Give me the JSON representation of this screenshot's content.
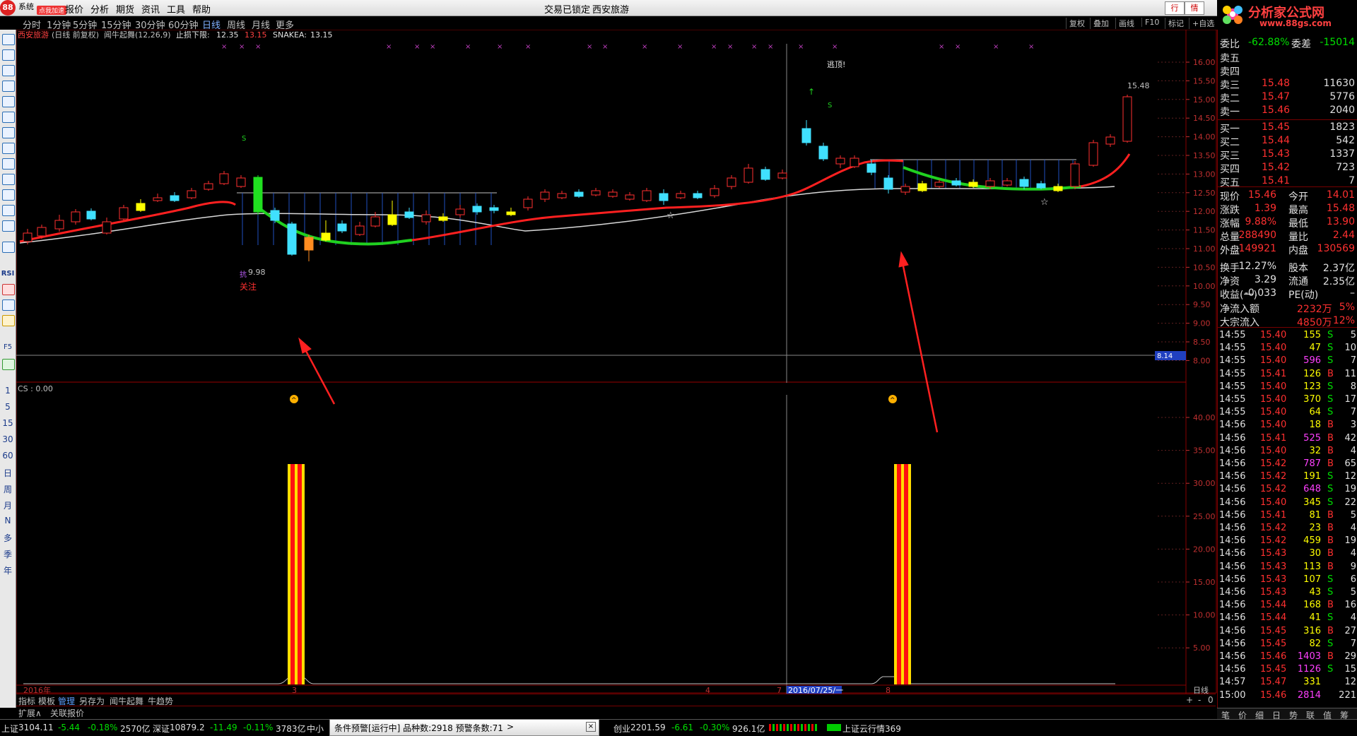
{
  "menu": {
    "items": [
      "系统",
      "报价",
      "分析",
      "期货",
      "资讯",
      "工具",
      "帮助"
    ],
    "badge": "点我加速",
    "logo": "88",
    "center_title": "交易已锁定",
    "stock_name": "西安旅游",
    "win_buttons": [
      "行",
      "情"
    ]
  },
  "periods": [
    "分时",
    "1分钟",
    "5分钟",
    "15分钟",
    "30分钟",
    "60分钟",
    "日线",
    "周线",
    "月线",
    "更多"
  ],
  "active_period": "日线",
  "right_tools": [
    "复权",
    "叠加",
    "画线",
    "F10",
    "标记",
    "+自选"
  ],
  "site_logo": {
    "name": "分析家公式网",
    "url": "www.88gs.com"
  },
  "chart_header": {
    "name": "西安旅游",
    "period": "(日线 前复权)",
    "indicator": "闻牛起舞(12,26,9)",
    "stop_label": "止损下限:",
    "stop_value": "12.35",
    "stop_value2": "13.15",
    "snake_label": "SNAKEA:",
    "snake_value": "13.15"
  },
  "annotations": {
    "top_text": "逃顶!",
    "low_label": "9.98",
    "low_text": "抗",
    "focus_text": "关注",
    "high_label": "15.48",
    "s_mark": "S",
    "price_tag": "8.14"
  },
  "price_axis": [
    "16.00",
    "15.50",
    "15.00",
    "14.50",
    "14.00",
    "13.50",
    "13.00",
    "12.50",
    "12.00",
    "11.50",
    "11.00",
    "10.50",
    "10.00",
    "9.50",
    "9.00",
    "8.50",
    "8.00"
  ],
  "indicator_header": "CS : 0.00",
  "indicator_axis": [
    "40.00",
    "35.00",
    "30.00",
    "25.00",
    "20.00",
    "15.00",
    "10.00",
    "5.00"
  ],
  "date_axis": {
    "year": "2016年",
    "m3": "3",
    "m4": "4",
    "m7": "7",
    "cursor": "2016/07/25/一",
    "m8": "8"
  },
  "timeframe_right": "日线",
  "left_labels": [
    "1",
    "5",
    "15",
    "30",
    "60",
    "日",
    "周",
    "月",
    "N",
    "多",
    "季",
    "年"
  ],
  "left_small": [
    "RSI",
    "F5"
  ],
  "bottom_tabs": [
    "指标",
    "模板",
    "管理",
    "另存为",
    "闻牛起舞",
    "牛趋势"
  ],
  "active_tab": "管理",
  "expand_tabs": [
    "扩展∧",
    "关联报价"
  ],
  "quote": {
    "weibi_label": "委比",
    "weibi": "-62.88%",
    "weicha_label": "委差",
    "weicha": "-15014",
    "sell": [
      {
        "label": "卖五",
        "price": "",
        "vol": ""
      },
      {
        "label": "卖四",
        "price": "",
        "vol": ""
      },
      {
        "label": "卖三",
        "price": "15.48",
        "vol": "11630"
      },
      {
        "label": "卖二",
        "price": "15.47",
        "vol": "5776"
      },
      {
        "label": "卖一",
        "price": "15.46",
        "vol": "2040"
      }
    ],
    "buy": [
      {
        "label": "买一",
        "price": "15.45",
        "vol": "1823"
      },
      {
        "label": "买二",
        "price": "15.44",
        "vol": "542"
      },
      {
        "label": "买三",
        "price": "15.43",
        "vol": "1337"
      },
      {
        "label": "买四",
        "price": "15.42",
        "vol": "723"
      },
      {
        "label": "买五",
        "price": "15.41",
        "vol": "7"
      }
    ],
    "stats": [
      {
        "l1": "现价",
        "v1": "15.46",
        "l2": "今开",
        "v2": "14.01"
      },
      {
        "l1": "涨跌",
        "v1": "1.39",
        "l2": "最高",
        "v2": "15.48"
      },
      {
        "l1": "涨幅",
        "v1": "9.88%",
        "l2": "最低",
        "v2": "13.90"
      },
      {
        "l1": "总量",
        "v1": "288490",
        "l2": "量比",
        "v2": "2.44"
      },
      {
        "l1": "外盘",
        "v1": "149921",
        "l2": "内盘",
        "v2": "130569"
      },
      {
        "l1": "换手",
        "v1": "12.27%",
        "l2": "股本",
        "v2": "2.37亿"
      },
      {
        "l1": "净资",
        "v1": "3.29",
        "l2": "流通",
        "v2": "2.35亿"
      },
      {
        "l1": "收益(一)",
        "v1": "-0.033",
        "l2": "PE(动)",
        "v2": "–"
      }
    ],
    "flows": [
      {
        "label": "净流入额",
        "value": "2232万",
        "pct": "5%"
      },
      {
        "label": "大宗流入",
        "value": "4850万",
        "pct": "12%"
      }
    ]
  },
  "ticks": [
    {
      "t": "14:55",
      "p": "15.40",
      "v": "155",
      "d": "S",
      "n": "5"
    },
    {
      "t": "14:55",
      "p": "15.40",
      "v": "47",
      "d": "S",
      "n": "10"
    },
    {
      "t": "14:55",
      "p": "15.40",
      "v": "596",
      "d": "S",
      "n": "7"
    },
    {
      "t": "14:55",
      "p": "15.41",
      "v": "126",
      "d": "B",
      "n": "11"
    },
    {
      "t": "14:55",
      "p": "15.40",
      "v": "123",
      "d": "S",
      "n": "8"
    },
    {
      "t": "14:55",
      "p": "15.40",
      "v": "370",
      "d": "S",
      "n": "17"
    },
    {
      "t": "14:55",
      "p": "15.40",
      "v": "64",
      "d": "S",
      "n": "7"
    },
    {
      "t": "14:56",
      "p": "15.40",
      "v": "18",
      "d": "B",
      "n": "3"
    },
    {
      "t": "14:56",
      "p": "15.41",
      "v": "525",
      "d": "B",
      "n": "42"
    },
    {
      "t": "14:56",
      "p": "15.40",
      "v": "32",
      "d": "B",
      "n": "4"
    },
    {
      "t": "14:56",
      "p": "15.42",
      "v": "787",
      "d": "B",
      "n": "65"
    },
    {
      "t": "14:56",
      "p": "15.42",
      "v": "191",
      "d": "S",
      "n": "12"
    },
    {
      "t": "14:56",
      "p": "15.42",
      "v": "648",
      "d": "S",
      "n": "19"
    },
    {
      "t": "14:56",
      "p": "15.40",
      "v": "345",
      "d": "S",
      "n": "22"
    },
    {
      "t": "14:56",
      "p": "15.41",
      "v": "81",
      "d": "B",
      "n": "5"
    },
    {
      "t": "14:56",
      "p": "15.42",
      "v": "23",
      "d": "B",
      "n": "4"
    },
    {
      "t": "14:56",
      "p": "15.42",
      "v": "459",
      "d": "B",
      "n": "19"
    },
    {
      "t": "14:56",
      "p": "15.43",
      "v": "30",
      "d": "B",
      "n": "4"
    },
    {
      "t": "14:56",
      "p": "15.43",
      "v": "113",
      "d": "B",
      "n": "9"
    },
    {
      "t": "14:56",
      "p": "15.43",
      "v": "107",
      "d": "S",
      "n": "6"
    },
    {
      "t": "14:56",
      "p": "15.43",
      "v": "43",
      "d": "S",
      "n": "5"
    },
    {
      "t": "14:56",
      "p": "15.44",
      "v": "168",
      "d": "B",
      "n": "16"
    },
    {
      "t": "14:56",
      "p": "15.44",
      "v": "41",
      "d": "S",
      "n": "4"
    },
    {
      "t": "14:56",
      "p": "15.45",
      "v": "316",
      "d": "B",
      "n": "27"
    },
    {
      "t": "14:56",
      "p": "15.45",
      "v": "82",
      "d": "S",
      "n": "7"
    },
    {
      "t": "14:56",
      "p": "15.46",
      "v": "1403",
      "d": "B",
      "n": "29"
    },
    {
      "t": "14:56",
      "p": "15.45",
      "v": "1126",
      "d": "S",
      "n": "15"
    },
    {
      "t": "14:57",
      "p": "15.47",
      "v": "331",
      "d": "",
      "n": "12"
    },
    {
      "t": "15:00",
      "p": "15.46",
      "v": "2814",
      "d": "",
      "n": "221"
    }
  ],
  "rfoot_tabs": [
    "笔",
    "价",
    "细",
    "日",
    "势",
    "联",
    "值",
    "筹"
  ],
  "status": {
    "sh_label": "上证",
    "sh_val": "3104.11",
    "sh_chg": "-5.44",
    "sh_pct": "-0.18%",
    "sh_amt": "2570亿",
    "sz_label": "深证",
    "sz_val": "10879.2",
    "sz_chg": "-11.49",
    "sz_pct": "-0.11%",
    "sz_amt": "3783亿",
    "zx_label": "中小",
    "alert": "条件预警[运行中] 品种数:2918 预警条数:71",
    "cy_label": "创业",
    "cy_val": "2201.59",
    "cy_chg": "-6.61",
    "cy_pct": "-0.30%",
    "cy_amt": "926.1亿",
    "cloud": "上证云行情369"
  }
}
